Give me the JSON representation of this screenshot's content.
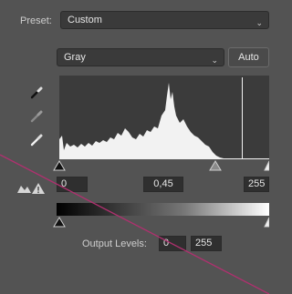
{
  "preset": {
    "label": "Preset:",
    "value": "Custom"
  },
  "channel": {
    "value": "Gray"
  },
  "auto_button": {
    "label": "Auto"
  },
  "input_levels": {
    "black": "0",
    "gamma": "0,45",
    "white": "255"
  },
  "output_levels": {
    "label": "Output Levels:",
    "black": "0",
    "white": "255"
  },
  "icons": [
    "eyedropper-black-icon",
    "eyedropper-gray-icon",
    "eyedropper-white-icon",
    "clipping-warning-icon"
  ],
  "colors": {
    "panel": "#535353",
    "field": "#3a3a3a",
    "annotation_line": "#b0306f"
  }
}
